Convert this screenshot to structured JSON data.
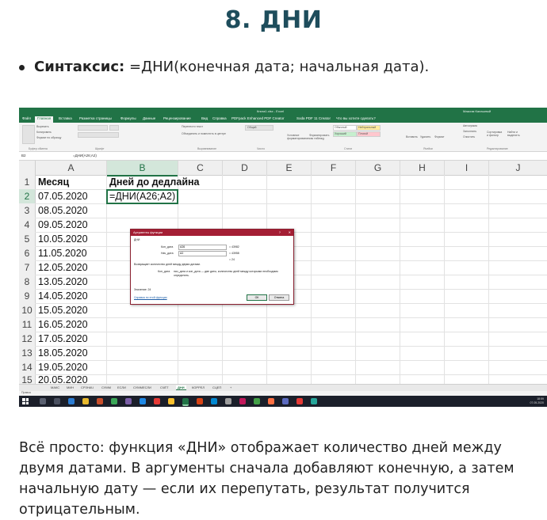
{
  "title": "8. ДНИ",
  "syntax": {
    "label": "Синтаксис:",
    "text": " =ДНИ(конечная дата; начальная дата)."
  },
  "screenshot": {
    "window_title": "Книга1.xlsx - Excel",
    "user": "Максим Калашный",
    "ribbon_tabs": [
      "Файл",
      "Главная",
      "Вставка",
      "Разметка страницы",
      "Формулы",
      "Данные",
      "Рецензирование",
      "Вид",
      "Справка",
      "PDFpack Enhanced PDF Creator",
      "Soda PDF 11 Creator",
      "Что вы хотите сделать?"
    ],
    "active_tab": "Главная",
    "ribbon_groups": [
      "Буфер обмена",
      "Шрифт",
      "Выравнивание",
      "Число",
      "Стили",
      "Ячейки",
      "Редактирование"
    ],
    "ribbon_items": {
      "cut": "Вырезать",
      "copy": "Копировать",
      "format_painter": "Формат по образцу",
      "wrap": "Перенести текст",
      "merge": "Объединить и поместить в центре",
      "format_number": "Общий",
      "cond_format": "Условное форматирование",
      "table_format": "Форматировать как таблицу",
      "normal": "Обычный",
      "neutral": "Нейтральный",
      "good": "Хороший",
      "bad": "Плохой",
      "insert": "Вставить",
      "delete": "Удалить",
      "format": "Формат",
      "autosum": "Автосумма",
      "fill": "Заполнить",
      "clear": "Очистить",
      "sort": "Сортировка и фильтр",
      "find": "Найти и выделить"
    },
    "name_box": "B2",
    "formula": "=ДНИ(A26;A2)",
    "columns": [
      "A",
      "B",
      "C",
      "D",
      "E",
      "F",
      "G",
      "H",
      "I",
      "J"
    ],
    "header_row": {
      "a": "Месяц",
      "b": "Дней до дедлайна"
    },
    "active_formula": "=ДНИ(A26;A2)",
    "dates": [
      "07.05.2020",
      "08.05.2020",
      "09.05.2020",
      "10.05.2020",
      "11.05.2020",
      "12.05.2020",
      "13.05.2020",
      "14.05.2020",
      "15.05.2020",
      "16.05.2020",
      "17.05.2020",
      "18.05.2020",
      "19.05.2020",
      "20.05.2020"
    ],
    "row_numbers": [
      "1",
      "2",
      "3",
      "4",
      "5",
      "6",
      "7",
      "8",
      "9",
      "10",
      "11",
      "12",
      "13",
      "14",
      "15"
    ],
    "dialog": {
      "title": "Аргументы функции",
      "func": "ДНИ",
      "arg1_label": "Кон_дата",
      "arg1_value": "A26",
      "arg1_result": "= 43982",
      "arg2_label": "Нач_дата",
      "arg2_value": "A2",
      "arg2_result": "= 43958",
      "total": "= 24",
      "description": "Возвращает количество дней между двумя датами.",
      "arg_desc_label": "Кон_дата",
      "arg_desc": "нач_дата и кон_дата — две даты, количество дней между которыми необходимо определить.",
      "value_label": "Значение: 24",
      "help_link": "Справка по этой функции",
      "ok": "ОК",
      "cancel": "Отмена",
      "help": "?",
      "close": "✕"
    },
    "sheet_tabs": [
      "МАКС",
      "МИН",
      "СРЗНАЧ",
      "СУММ",
      "ЕСЛИ",
      "СУММЕСЛИ",
      "СЧЁТ",
      "ДНИ",
      "КОРРЕЛ",
      "СЦЕП"
    ],
    "active_sheet": "ДНИ",
    "add_sheet": "+",
    "status": "Правка",
    "clock": {
      "time": "18:59",
      "date": "07.05.2020"
    }
  },
  "paragraph": "Всё просто: функция «ДНИ» отображает количество дней между двумя датами. В аргументы сначала добавляют конечную, а затем начальную дату — если их перепутать, результат получится отрицательным.",
  "colors": {
    "title": "#1e4d5c",
    "excel_green": "#217346",
    "dialog_title": "#a41e34"
  }
}
